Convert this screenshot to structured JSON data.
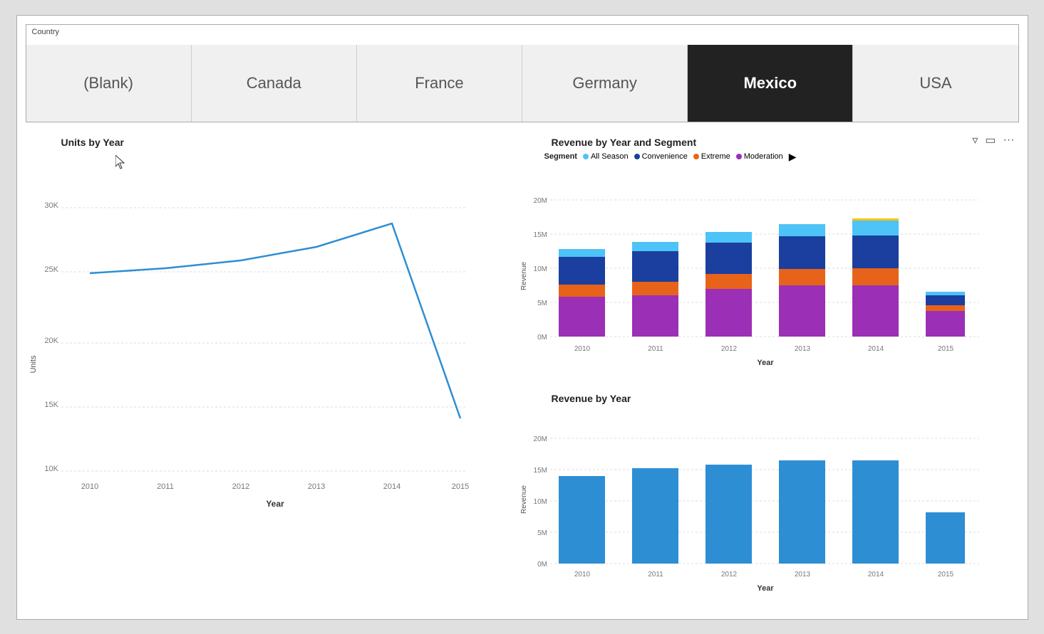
{
  "slicer": {
    "label": "Country",
    "items": [
      {
        "label": "(Blank)",
        "active": false
      },
      {
        "label": "Canada",
        "active": false
      },
      {
        "label": "France",
        "active": false
      },
      {
        "label": "Germany",
        "active": false
      },
      {
        "label": "Mexico",
        "active": true
      },
      {
        "label": "USA",
        "active": false
      }
    ]
  },
  "toolbar": {
    "filter_icon": "▽",
    "expand_icon": "⊡",
    "more_icon": "···"
  },
  "units_chart": {
    "title": "Units by Year",
    "y_axis_label": "Units",
    "x_axis_label": "Year",
    "y_ticks": [
      "30K",
      "25K",
      "20K",
      "15K",
      "10K"
    ],
    "x_ticks": [
      "2010",
      "2011",
      "2012",
      "2013",
      "2014",
      "2015"
    ],
    "data": [
      {
        "year": "2010",
        "value": 25000
      },
      {
        "year": "2011",
        "value": 25400
      },
      {
        "year": "2012",
        "value": 26000
      },
      {
        "year": "2013",
        "value": 27000
      },
      {
        "year": "2014",
        "value": 28800
      },
      {
        "year": "2015",
        "value": 14000
      }
    ]
  },
  "revenue_segment_chart": {
    "title": "Revenue by Year and Segment",
    "segment_label": "Segment",
    "legend": [
      {
        "label": "All Season",
        "color": "#4dc3f7"
      },
      {
        "label": "Convenience",
        "color": "#1a3f9e"
      },
      {
        "label": "Extreme",
        "color": "#e8631a"
      },
      {
        "label": "Moderation",
        "color": "#9b2fb5"
      }
    ],
    "y_axis_label": "Revenue",
    "x_axis_label": "Year",
    "y_ticks": [
      "20M",
      "15M",
      "10M",
      "5M",
      "0M"
    ],
    "x_ticks": [
      "2010",
      "2011",
      "2012",
      "2013",
      "2014",
      "2015"
    ],
    "data": [
      {
        "year": "2010",
        "allSeason": 1.2,
        "convenience": 4.2,
        "extreme": 1.8,
        "moderation": 5.8
      },
      {
        "year": "2011",
        "allSeason": 1.4,
        "convenience": 4.5,
        "extreme": 2.0,
        "moderation": 6.0
      },
      {
        "year": "2012",
        "allSeason": 1.6,
        "convenience": 4.6,
        "extreme": 2.2,
        "moderation": 7.0
      },
      {
        "year": "2013",
        "allSeason": 1.8,
        "convenience": 4.8,
        "extreme": 2.4,
        "moderation": 7.5
      },
      {
        "year": "2014",
        "allSeason": 2.2,
        "convenience": 4.8,
        "extreme": 2.5,
        "moderation": 7.5
      },
      {
        "year": "2015",
        "allSeason": 0.5,
        "convenience": 1.5,
        "extreme": 0.8,
        "moderation": 3.8
      }
    ]
  },
  "revenue_year_chart": {
    "title": "Revenue by Year",
    "y_axis_label": "Revenue",
    "x_axis_label": "Year",
    "y_ticks": [
      "20M",
      "15M",
      "10M",
      "5M",
      "0M"
    ],
    "x_ticks": [
      "2010",
      "2011",
      "2012",
      "2013",
      "2014",
      "2015"
    ],
    "data": [
      {
        "year": "2010",
        "value": 14.0
      },
      {
        "year": "2011",
        "value": 15.2
      },
      {
        "year": "2012",
        "value": 15.8
      },
      {
        "year": "2013",
        "value": 16.5
      },
      {
        "year": "2014",
        "value": 16.5
      },
      {
        "year": "2015",
        "value": 8.2
      }
    ]
  }
}
